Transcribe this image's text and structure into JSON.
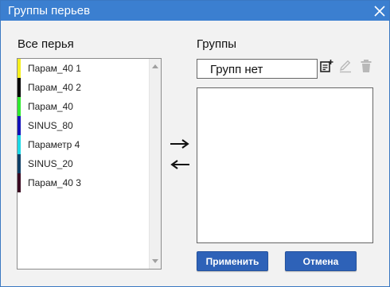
{
  "dialog": {
    "title": "Группы перьев"
  },
  "pens": {
    "heading": "Все перья",
    "items": [
      {
        "label": "Парам_40 1",
        "color": "#f5ef1d"
      },
      {
        "label": "Парам_40 2",
        "color": "#050505"
      },
      {
        "label": "Парам_40",
        "color": "#2ee92e"
      },
      {
        "label": "SINUS_80",
        "color": "#1010b8"
      },
      {
        "label": "Параметр 4",
        "color": "#1ad8e6"
      },
      {
        "label": "SINUS_20",
        "color": "#0e3f66"
      },
      {
        "label": "Парам_40 3",
        "color": "#3a0a22"
      }
    ]
  },
  "groups": {
    "heading": "Группы",
    "selected": "Групп нет"
  },
  "icons": {
    "close": "close-icon",
    "move_right": "arrow-right-icon",
    "move_left": "arrow-left-icon",
    "add_group": "add-list-icon",
    "rename_group": "pencil-icon",
    "delete_group": "trash-icon"
  },
  "buttons": {
    "apply": "Применить",
    "cancel": "Отмена"
  },
  "colors": {
    "title_bar": "#3b7fd0",
    "button": "#2e62b8",
    "dialog_bg": "#f2f2f2"
  }
}
